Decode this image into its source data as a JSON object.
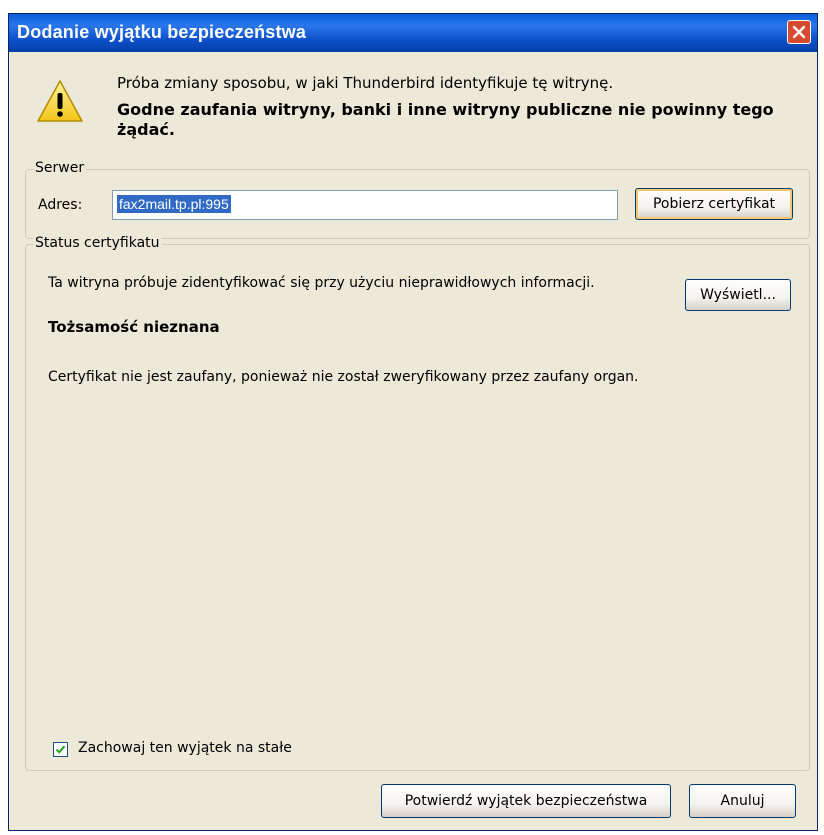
{
  "window": {
    "title": "Dodanie wyjątku bezpieczeństwa"
  },
  "intro": {
    "line1": "Próba zmiany sposobu, w jaki Thunderbird identyfikuje tę witrynę.",
    "line2": "Godne zaufania witryny, banki i inne witryny publiczne nie powinny tego żądać."
  },
  "server": {
    "legend": "Serwer",
    "address_label": "Adres:",
    "address_value": "fax2mail.tp.pl:995",
    "get_cert_button": "Pobierz certyfikat"
  },
  "status": {
    "legend": "Status certyfikatu",
    "message": "Ta witryna próbuje zidentyfikować się przy użyciu nieprawidłowych informacji.",
    "view_button": "Wyświetl...",
    "identity_heading": "Tożsamość nieznana",
    "identity_detail": "Certyfikat nie jest zaufany, ponieważ nie został zweryfikowany przez zaufany organ."
  },
  "permanent": {
    "checkbox_label": "Zachowaj ten wyjątek na stałe",
    "checked": true
  },
  "footer": {
    "confirm_button": "Potwierdź wyjątek bezpieczeństwa",
    "cancel_button": "Anuluj"
  },
  "colors": {
    "titlebar": "#0b4fc8",
    "dialog_bg": "#ece9d8",
    "selection": "#316ac5",
    "close": "#d84a2e"
  },
  "icons": {
    "warning": "warning-icon",
    "close": "close-icon",
    "check": "checkmark-icon"
  }
}
